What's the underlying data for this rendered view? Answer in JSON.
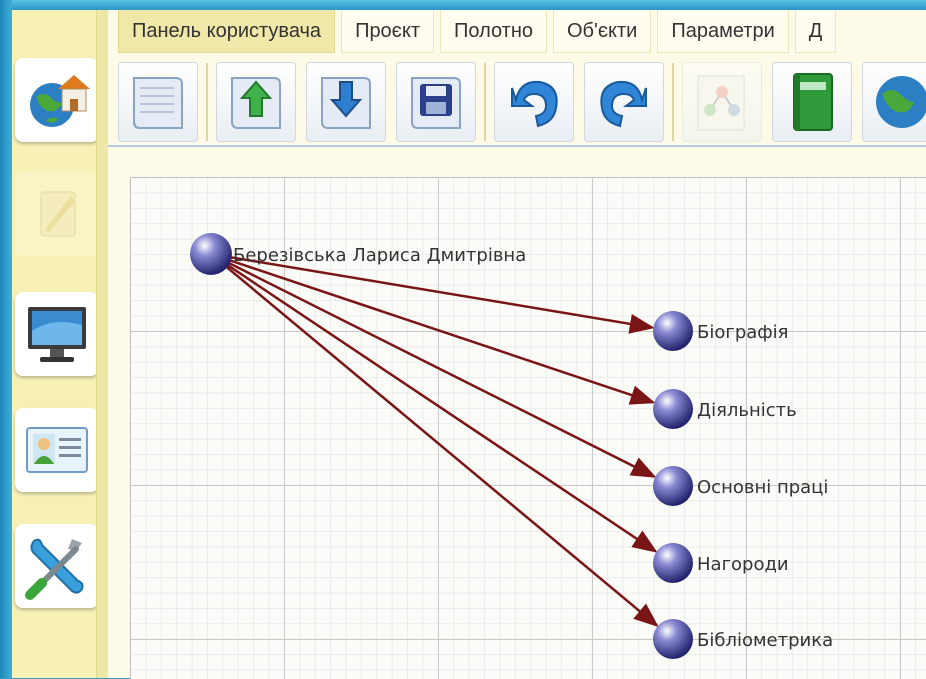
{
  "menu": {
    "tabs": [
      {
        "label": "Панель користувача",
        "active": true
      },
      {
        "label": "Проєкт"
      },
      {
        "label": "Полотно"
      },
      {
        "label": "Об'єкти"
      },
      {
        "label": "Параметри"
      },
      {
        "label": "Д"
      }
    ]
  },
  "toolbar": {
    "buttons": [
      {
        "icon": "new-document-icon"
      },
      {
        "icon": "upload-document-icon"
      },
      {
        "icon": "download-document-icon"
      },
      {
        "icon": "save-document-icon"
      },
      {
        "icon": "undo-icon"
      },
      {
        "icon": "redo-icon"
      },
      {
        "icon": "graph-structure-icon",
        "disabled": true
      },
      {
        "icon": "green-book-icon"
      },
      {
        "icon": "globe-icon"
      }
    ]
  },
  "sidebar": {
    "items": [
      {
        "icon": "globe-house-icon"
      },
      {
        "icon": "quill-icon",
        "disabled": true
      },
      {
        "icon": "monitor-icon"
      },
      {
        "icon": "profile-card-icon"
      },
      {
        "icon": "tools-icon"
      }
    ]
  },
  "diagram": {
    "root": {
      "label": "Березівська Лариса Дмитрівна"
    },
    "children": [
      {
        "label": "Біографія"
      },
      {
        "label": "Діяльність"
      },
      {
        "label": "Основні праці"
      },
      {
        "label": "Нагороди"
      },
      {
        "label": "Бібліометрика"
      }
    ],
    "colors": {
      "edge": "#7a1515",
      "node": "#34348a",
      "node_highlight": "#ffffff"
    }
  }
}
